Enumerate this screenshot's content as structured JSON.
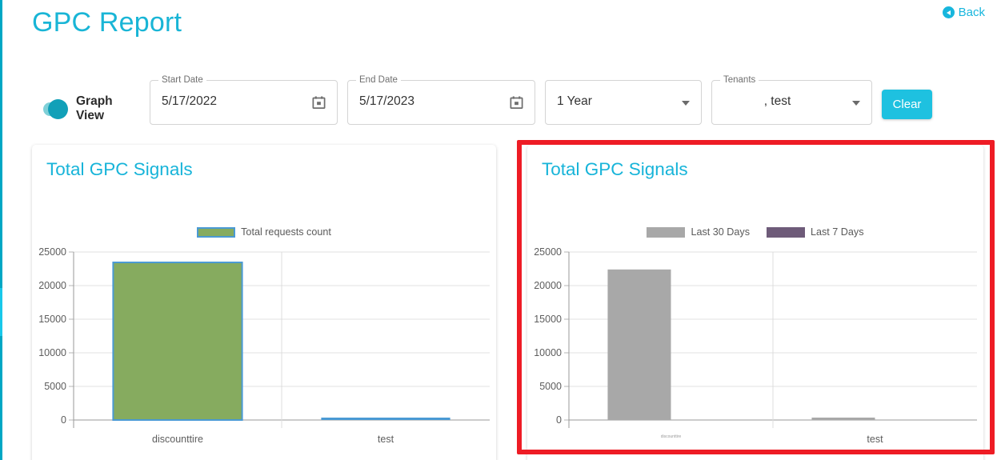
{
  "header": {
    "title": "GPC Report",
    "back_label": "Back",
    "back_icon": "back-circle-arrow-icon"
  },
  "toolbar": {
    "graph_view_label": "Graph View",
    "graph_view_on": true,
    "start_date": {
      "label": "Start Date",
      "value": "5/17/2022",
      "icon": "calendar-icon"
    },
    "end_date": {
      "label": "End Date",
      "value": "5/17/2023",
      "icon": "calendar-icon"
    },
    "range": {
      "label": "",
      "value": "1 Year",
      "icon": "chevron-down-icon"
    },
    "tenants": {
      "label": "Tenants",
      "value": ", test",
      "icon": "chevron-down-icon"
    },
    "clear_label": "Clear"
  },
  "colors": {
    "accent": "#19b5d6",
    "button": "#1ec1e0",
    "toggle_track": "#7fd0d8",
    "toggle_knob": "#11a0b8",
    "highlight": "#ee1c25",
    "green_bar": "#86ab5f",
    "green_bar_border": "#4a9ad4",
    "gray_bar": "#a8a8a8",
    "purple_bar": "#6e5b79"
  },
  "cards": {
    "left_title": "Total GPC Signals",
    "right_title": "Total GPC Signals"
  },
  "chart_data": [
    {
      "id": "left",
      "type": "bar",
      "title": "Total GPC Signals",
      "categories": [
        "discounttire",
        "test"
      ],
      "series": [
        {
          "name": "Total requests count",
          "color": "#86ab5f",
          "border": "#4a9ad4",
          "values": [
            23450,
            150
          ]
        }
      ],
      "legend": [
        "Total requests count"
      ],
      "legend_position": "top-center",
      "ylabel": "",
      "xlabel": "",
      "ylim": [
        0,
        25000
      ],
      "yticks": [
        0,
        5000,
        10000,
        15000,
        20000,
        25000
      ],
      "ytick_labels": [
        "0",
        "5000",
        "10000",
        "15000",
        "20000",
        "25000"
      ],
      "grid": true
    },
    {
      "id": "right",
      "type": "bar",
      "title": "Total GPC Signals",
      "categories": [
        "discounttire",
        "test"
      ],
      "series": [
        {
          "name": "Last 30 Days",
          "color": "#a8a8a8",
          "values": [
            22400,
            170
          ]
        },
        {
          "name": "Last 7 Days",
          "color": "#6e5b79",
          "values": [
            0,
            0
          ]
        }
      ],
      "legend": [
        "Last 30 Days",
        "Last 7 Days"
      ],
      "legend_position": "top-center",
      "ylabel": "",
      "xlabel": "",
      "ylim": [
        0,
        25000
      ],
      "yticks": [
        0,
        5000,
        10000,
        15000,
        20000,
        25000
      ],
      "ytick_labels": [
        "0",
        "5000",
        "10000",
        "15000",
        "20000",
        "25000"
      ],
      "grid": true,
      "xlabel_clipped_first": true
    }
  ]
}
